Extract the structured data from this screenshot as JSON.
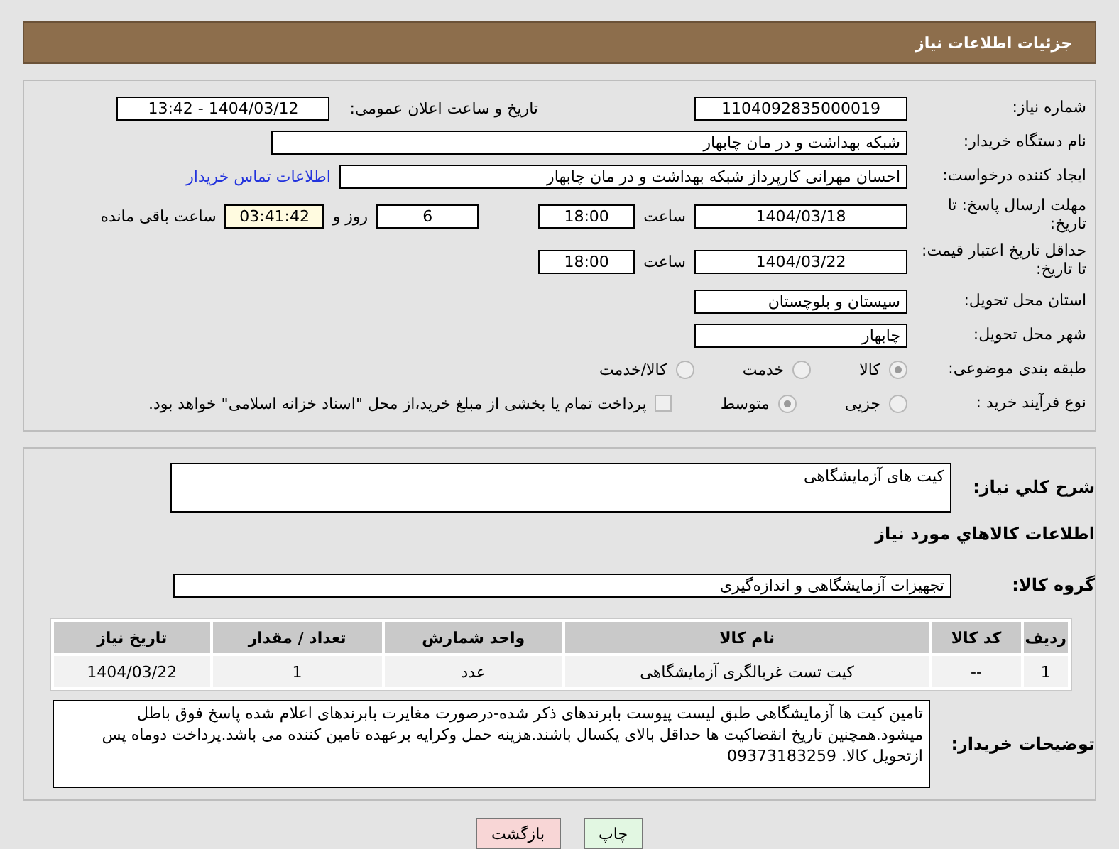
{
  "header": {
    "title": "جزئیات اطلاعات نیاز"
  },
  "need_number": {
    "label": "شماره نیاز:",
    "value": "1104092835000019"
  },
  "announce_date": {
    "label": "تاریخ و ساعت اعلان عمومی:",
    "value": "1404/03/12 - 13:42"
  },
  "buyer_org": {
    "label": "نام دستگاه خریدار:",
    "value": "شبکه بهداشت و در مان چابهار"
  },
  "requester": {
    "label": "ایجاد کننده درخواست:",
    "value": "احسان مهرانی کارپرداز شبکه بهداشت و در مان چابهار",
    "link": "اطلاعات تماس خریدار"
  },
  "response_deadline": {
    "label": "مهلت ارسال پاسخ: تا تاریخ:",
    "date": "1404/03/18",
    "time_label": "ساعت",
    "time": "18:00",
    "days": "6",
    "days_label": "روز و",
    "remaining": "03:41:42",
    "remaining_label": "ساعت باقی مانده"
  },
  "price_validity": {
    "label": "حداقل تاریخ اعتبار قیمت: تا تاریخ:",
    "date": "1404/03/22",
    "time_label": "ساعت",
    "time": "18:00"
  },
  "province": {
    "label": "استان محل تحویل:",
    "value": "سیستان و بلوچستان"
  },
  "city": {
    "label": "شهر محل تحویل:",
    "value": "چابهار"
  },
  "category": {
    "label": "طبقه بندی موضوعی:",
    "options": [
      {
        "label": "کالا",
        "selected": true
      },
      {
        "label": "خدمت",
        "selected": false
      },
      {
        "label": "کالا/خدمت",
        "selected": false
      }
    ]
  },
  "purchase_type": {
    "label": "نوع فرآیند خرید :",
    "options": [
      {
        "label": "جزیی",
        "selected": false
      },
      {
        "label": "متوسط",
        "selected": true
      }
    ],
    "treasury": {
      "checked": false,
      "text": "پرداخت تمام یا بخشی از مبلغ خرید،از محل \"اسناد خزانه اسلامی\" خواهد بود."
    }
  },
  "summary": {
    "label": "شرح کلي نياز:",
    "value": "کیت های آزمایشگاهی"
  },
  "goods_title": "اطلاعات کالاهاي مورد نياز",
  "goods_group": {
    "label": "گروه کالا:",
    "value": "تجهیزات آزمایشگاهی و اندازه‌گیری"
  },
  "table": {
    "columns": [
      "ردیف",
      "کد کالا",
      "نام کالا",
      "واحد شمارش",
      "تعداد / مقدار",
      "تاریخ نیاز"
    ],
    "rows": [
      [
        "1",
        "--",
        "کیت تست غربالگری آزمایشگاهی",
        "عدد",
        "1",
        "1404/03/22"
      ]
    ]
  },
  "buyer_notes": {
    "label": "توضیحات خریدار:",
    "value": "تامین کیت ها آزمایشگاهی طبق لیست پیوست بابرندهای ذکر شده-درصورت مغایرت بابرندهای اعلام شده پاسخ فوق باطل میشود.همچنین تاریخ انقضاکیت ها حداقل بالای یکسال باشند.هزینه حمل وکرایه برعهده تامین کننده می باشد.پرداخت دوماه پس ازتحویل کالا. 09373183259"
  },
  "buttons": [
    {
      "kind": "print",
      "label": "چاپ"
    },
    {
      "kind": "back",
      "label": "بازگشت"
    }
  ]
}
